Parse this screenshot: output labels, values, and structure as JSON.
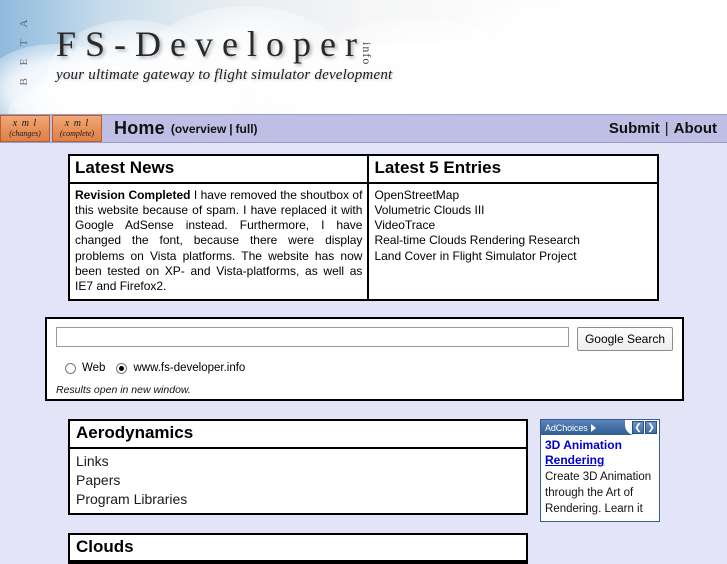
{
  "banner": {
    "beta_label": "B E T A",
    "logo_main": "FS-Developer",
    "logo_suffix": "info",
    "tagline": "your ultimate gateway to flight simulator development"
  },
  "nav": {
    "xml_changes_line1": "x m l",
    "xml_changes_line2": "(changes)",
    "xml_complete_line1": "x m l",
    "xml_complete_line2": "(complete)",
    "home_label": "Home",
    "home_sub_open": "(",
    "overview_label": "overview",
    "home_sub_sep": "|",
    "full_label": "full",
    "home_sub_close": ")",
    "submit_label": "Submit",
    "separator": "|",
    "about_label": "About"
  },
  "news": {
    "title": "Latest News",
    "headline": "Revision Completed",
    "body": " I have removed the shoutbox of this website because of spam. I have replaced it with Google AdSense instead. Furthermore, I have changed the font, because there were display problems on Vista platforms. The website has now been tested on XP- and Vista-platforms, as well as IE7 and Firefox2."
  },
  "entries": {
    "title": "Latest 5 Entries",
    "items": [
      "OpenStreetMap",
      "Volumetric Clouds III",
      "VideoTrace",
      "Real-time Clouds Rendering Research",
      "Land Cover in Flight Simulator Project"
    ]
  },
  "search": {
    "value": "",
    "placeholder": "",
    "button_label": "Google Search",
    "scope_web_label": "Web",
    "scope_site_label": "www.fs-developer.info",
    "selected_scope": "www.fs-developer.info",
    "note": "Results open in new window."
  },
  "categories": [
    {
      "title": "Aerodynamics",
      "items": [
        "Links",
        "Papers",
        "Program Libraries"
      ]
    },
    {
      "title": "Clouds",
      "items": []
    }
  ],
  "ad": {
    "adchoices_label": "AdChoices",
    "prev_arrow": "❮",
    "next_arrow": "❯",
    "title_line1": "3D Animation",
    "title_line2": "Rendering",
    "body": "Create 3D Animation through the Art of Rendering. Learn it"
  },
  "colors": {
    "page_background": "#e4e4f8",
    "navbar": "#bfbfe6",
    "xml_button": "#e8935c",
    "ad_header": "#3f6ca6",
    "ad_link": "#0000cc"
  }
}
